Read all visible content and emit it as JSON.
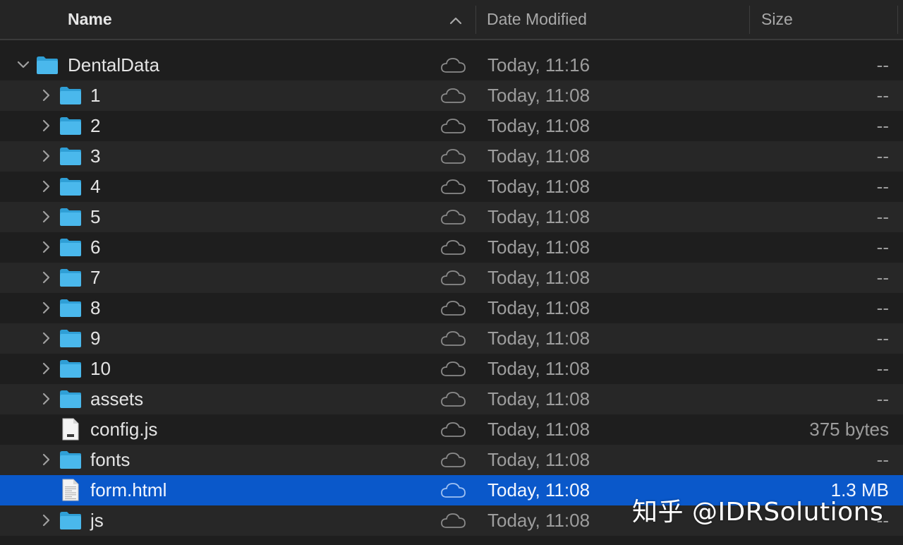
{
  "header": {
    "name_label": "Name",
    "date_label": "Date Modified",
    "size_label": "Size"
  },
  "colors": {
    "folder": "#4ab8ec",
    "folder_tab": "#2f9fd6",
    "selection": "#0a58ca"
  },
  "rows": [
    {
      "name": "DentalData",
      "kind": "folder",
      "level": 0,
      "expanded": true,
      "date": "Today, 11:16",
      "size": "--",
      "selected": false
    },
    {
      "name": "1",
      "kind": "folder",
      "level": 1,
      "expanded": false,
      "date": "Today, 11:08",
      "size": "--",
      "selected": false
    },
    {
      "name": "2",
      "kind": "folder",
      "level": 1,
      "expanded": false,
      "date": "Today, 11:08",
      "size": "--",
      "selected": false
    },
    {
      "name": "3",
      "kind": "folder",
      "level": 1,
      "expanded": false,
      "date": "Today, 11:08",
      "size": "--",
      "selected": false
    },
    {
      "name": "4",
      "kind": "folder",
      "level": 1,
      "expanded": false,
      "date": "Today, 11:08",
      "size": "--",
      "selected": false
    },
    {
      "name": "5",
      "kind": "folder",
      "level": 1,
      "expanded": false,
      "date": "Today, 11:08",
      "size": "--",
      "selected": false
    },
    {
      "name": "6",
      "kind": "folder",
      "level": 1,
      "expanded": false,
      "date": "Today, 11:08",
      "size": "--",
      "selected": false
    },
    {
      "name": "7",
      "kind": "folder",
      "level": 1,
      "expanded": false,
      "date": "Today, 11:08",
      "size": "--",
      "selected": false
    },
    {
      "name": "8",
      "kind": "folder",
      "level": 1,
      "expanded": false,
      "date": "Today, 11:08",
      "size": "--",
      "selected": false
    },
    {
      "name": "9",
      "kind": "folder",
      "level": 1,
      "expanded": false,
      "date": "Today, 11:08",
      "size": "--",
      "selected": false
    },
    {
      "name": "10",
      "kind": "folder",
      "level": 1,
      "expanded": false,
      "date": "Today, 11:08",
      "size": "--",
      "selected": false
    },
    {
      "name": "assets",
      "kind": "folder",
      "level": 1,
      "expanded": false,
      "date": "Today, 11:08",
      "size": "--",
      "selected": false
    },
    {
      "name": "config.js",
      "kind": "js-file",
      "level": 1,
      "expanded": false,
      "date": "Today, 11:08",
      "size": "375 bytes",
      "selected": false
    },
    {
      "name": "fonts",
      "kind": "folder",
      "level": 1,
      "expanded": false,
      "date": "Today, 11:08",
      "size": "--",
      "selected": false
    },
    {
      "name": "form.html",
      "kind": "html-file",
      "level": 1,
      "expanded": false,
      "date": "Today, 11:08",
      "size": "1.3 MB",
      "selected": true
    },
    {
      "name": "js",
      "kind": "folder",
      "level": 1,
      "expanded": false,
      "date": "Today, 11:08",
      "size": "--",
      "selected": false
    }
  ],
  "watermark": "知乎 @IDRSolutions"
}
